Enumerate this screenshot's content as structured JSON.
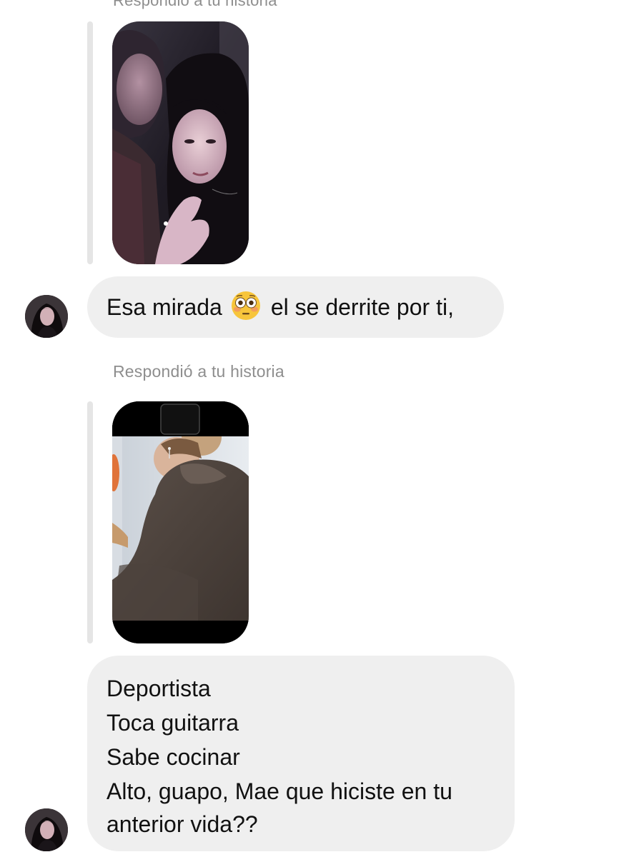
{
  "conversation": {
    "top_label_cut": "Respondió a tu historia",
    "message_1": {
      "text_before": "Esa mirada",
      "emoji": "flushed-face-emoji",
      "text_after": "el se derrite por ti,"
    },
    "reply_label_2": "Respondió a tu historia",
    "message_2": {
      "lines": [
        "Deportista",
        "Toca  guitarra",
        "Sabe cocinar",
        "Alto, guapo, Mae que hiciste en tu",
        "anterior vida??"
      ]
    }
  },
  "icons": {
    "avatar_1": "avatar-photo",
    "avatar_2": "avatar-photo",
    "story_1": "story-photo-couple",
    "story_2": "story-photo-hoodie"
  },
  "colors": {
    "bubble_background": "#efefef",
    "reply_line": "#e5e5e5",
    "muted_text": "#8e8e8e"
  }
}
